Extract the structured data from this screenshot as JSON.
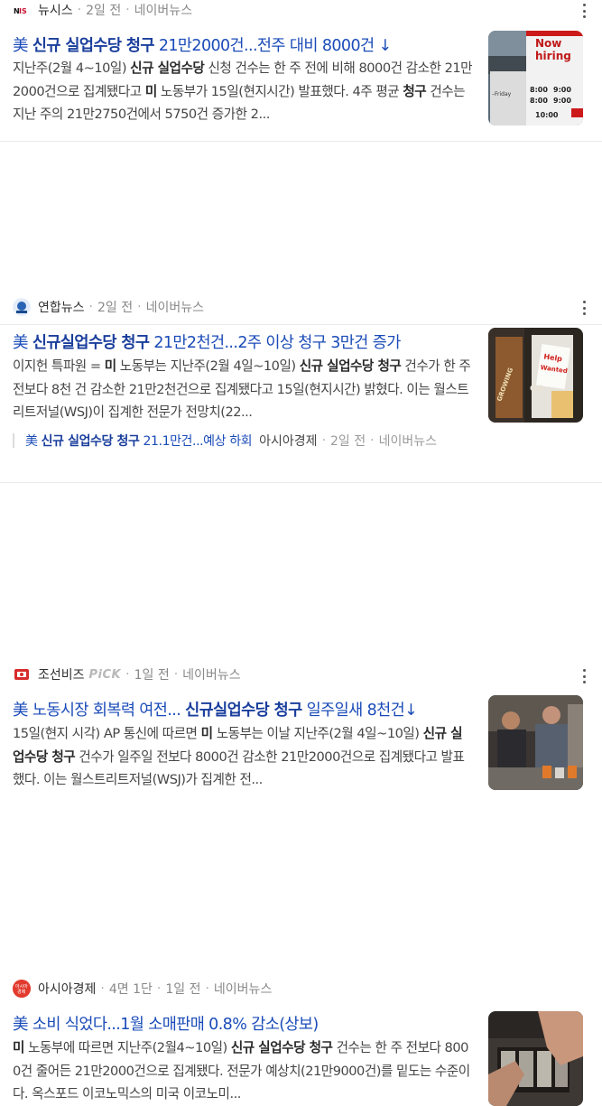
{
  "articles": [
    {
      "press": "뉴시스",
      "time": "2일 전",
      "portal": "네이버뉴스",
      "title_pre": "美 ",
      "title_hl": "신규 실업수당 청구",
      "title_post": " 21만2000건...전주 대비 8000건 ↓",
      "desc": [
        {
          "t": "지난주(2월 4~10일) ",
          "b": false
        },
        {
          "t": "신규 실업수당",
          "b": true
        },
        {
          "t": " 신청 건수는 한 주 전에 비해 8000건 감소한 21만2000건으로 집계됐다고 ",
          "b": false
        },
        {
          "t": "미",
          "b": true
        },
        {
          "t": " 노동부가 15일(현지시간) 발표했다. 4주 평균 ",
          "b": false
        },
        {
          "t": "청구",
          "b": true
        },
        {
          "t": " 건수는 지난 주의 21만2750건에서 5750건 증가한 2...",
          "b": false
        }
      ],
      "thumb_text": [
        "Now",
        "hiring",
        "–Friday",
        "8:00",
        "9:00",
        "8:00",
        "9:00",
        "10:00"
      ]
    },
    {
      "press": "연합뉴스",
      "time": "2일 전",
      "portal": "네이버뉴스",
      "title_pre": "美 ",
      "title_hl": "신규실업수당 청구",
      "title_post": " 21만2천건...2주 이상 청구 3만건 증가",
      "desc": [
        {
          "t": "이지헌 특파원 = ",
          "b": false
        },
        {
          "t": "미",
          "b": true
        },
        {
          "t": " 노동부는 지난주(2월 4일~10일) ",
          "b": false
        },
        {
          "t": "신규 실업수당 청구",
          "b": true
        },
        {
          "t": " 건수가 한 주 전보다 8천 건 감소한 21만2천건으로 집계됐다고 15일(현지시간) 밝혔다. 이는 월스트리트저널(WSJ)이 집계한 전문가 전망치(22...",
          "b": false
        }
      ],
      "thumb_text": [
        "Help",
        "Wanted",
        "GROWING",
        "GO"
      ],
      "related": {
        "title_pre": "美 ",
        "title_hl": "신규 실업수당 청구",
        "title_post": " 21.1만건...예상 하회",
        "press": "아시아경제",
        "time": "2일 전",
        "portal": "네이버뉴스"
      }
    },
    {
      "press": "조선비즈",
      "pick": "PiCK",
      "time": "1일 전",
      "portal": "네이버뉴스",
      "title_pre": "美 노동시장 회복력 여전... ",
      "title_hl": "신규실업수당 청구",
      "title_post": " 일주일새 8천건↓",
      "desc": [
        {
          "t": "15일(현지 시각) AP 통신에 따르면 ",
          "b": false
        },
        {
          "t": "미",
          "b": true
        },
        {
          "t": " 노동부는 이날 지난주(2월 4일~10일) ",
          "b": false
        },
        {
          "t": "신규 실업수당 청구",
          "b": true
        },
        {
          "t": " 건수가 일주일 전보다 8000건 감소한 21만2000건으로 집계됐다고 발표했다. 이는 월스트리트저널(WSJ)가 집계한 전...",
          "b": false
        }
      ]
    },
    {
      "press": "아시아경제",
      "page": "4면 1단",
      "time": "1일 전",
      "portal": "네이버뉴스",
      "title_pre": "美 소비 식었다...1월 소매판매 0.8% 감소(상보)",
      "title_hl": "",
      "title_post": "",
      "desc": [
        {
          "t": "미",
          "b": true
        },
        {
          "t": " 노동부에 따르면 지난주(2월4~10일) ",
          "b": false
        },
        {
          "t": "신규 실업수당 청구",
          "b": true
        },
        {
          "t": " 건수는 한 주 전보다 8000건 줄어든 21만2000건으로 집계됐다. 전문가 예상치(21만9000건)를 밑도는 수준이다. 옥스포드 이코노믹스의 미국 이코노미...",
          "b": false
        }
      ]
    }
  ],
  "logos": {
    "newsis": "NIS",
    "yonhap": "연합",
    "chosun": "조선",
    "asiae": "아시아\n경제"
  },
  "colors": {
    "title": "#1a4bb8",
    "highlight": "#1a3e9c",
    "meta": "#888888"
  }
}
